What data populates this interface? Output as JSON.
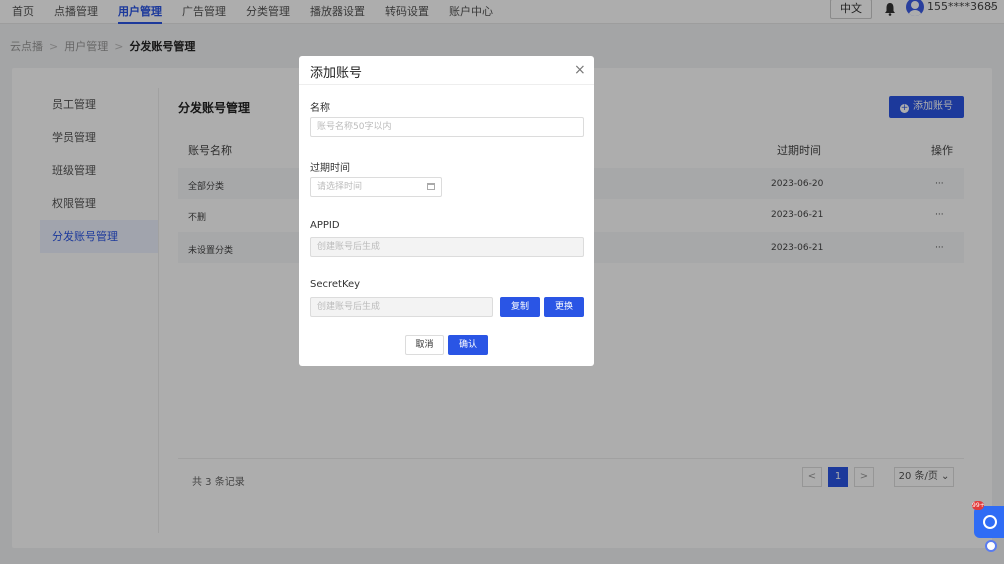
{
  "topnav": {
    "items": [
      {
        "label": "首页",
        "active": false
      },
      {
        "label": "点播管理",
        "active": false
      },
      {
        "label": "用户管理",
        "active": true
      },
      {
        "label": "广告管理",
        "active": false
      },
      {
        "label": "分类管理",
        "active": false
      },
      {
        "label": "播放器设置",
        "active": false
      },
      {
        "label": "转码设置",
        "active": false
      },
      {
        "label": "账户中心",
        "active": false
      }
    ],
    "lang": "中文",
    "user": "155****3685",
    "bell_icon": "bell-icon",
    "avatar_icon": "user-avatar-icon"
  },
  "breadcrumb": {
    "items": [
      "云点播",
      "用户管理",
      "分发账号管理"
    ],
    "separator": ">"
  },
  "sidebar": {
    "items": [
      {
        "label": "员工管理"
      },
      {
        "label": "学员管理"
      },
      {
        "label": "班级管理"
      },
      {
        "label": "权限管理"
      },
      {
        "label": "分发账号管理"
      }
    ]
  },
  "content": {
    "title": "分发账号管理",
    "add_button": "添加账号",
    "columns": {
      "name": "账号名称",
      "expire": "过期时间",
      "action": "操作"
    },
    "rows": [
      {
        "name": "全部分类",
        "expire": "2023-06-20",
        "action": "···"
      },
      {
        "name": "不删",
        "expire": "2023-06-21",
        "action": "···"
      },
      {
        "name": "未设置分类",
        "expire": "2023-06-21",
        "action": "···"
      }
    ],
    "total": "共 3 条记录",
    "pager": {
      "prev": "<",
      "current": "1",
      "next": ">",
      "size": "20 条/页 ⌄"
    }
  },
  "dialog": {
    "title": "添加账号",
    "close": "×",
    "fields": {
      "name_label": "名称",
      "name_placeholder": "账号名称50字以内",
      "expire_label": "过期时间",
      "expire_placeholder": "请选择时间",
      "appid_label": "APPID",
      "appid_placeholder": "创建账号后生成",
      "secret_label": "SecretKey",
      "secret_placeholder": "创建账号后生成"
    },
    "copy_button": "复制",
    "replace_button": "更换",
    "cancel_button": "取消",
    "confirm_button": "确认"
  },
  "widget": {
    "badge": "99+"
  },
  "colors": {
    "primary": "#2a55e5"
  }
}
